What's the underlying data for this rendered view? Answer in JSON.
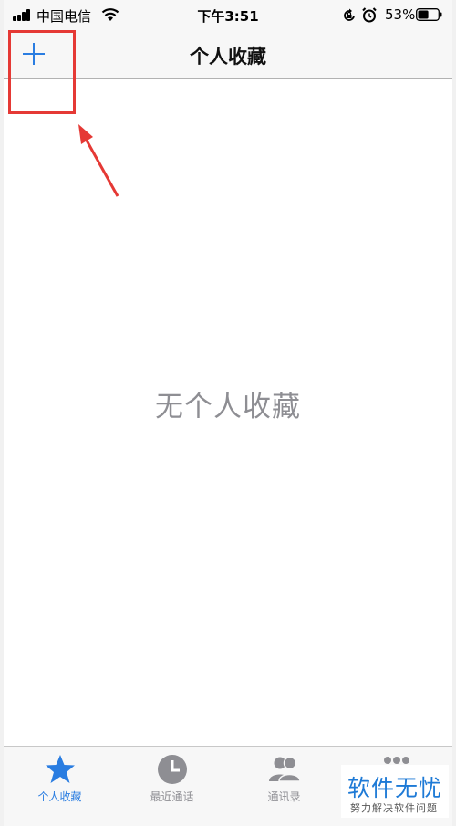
{
  "status_bar": {
    "carrier": "中国电信",
    "time": "下午3:51",
    "battery_percent": "53%",
    "battery_level": 0.53
  },
  "nav": {
    "title": "个人收藏",
    "add_icon": "plus-icon"
  },
  "main": {
    "empty_text": "无个人收藏"
  },
  "tabs": [
    {
      "label": "个人收藏",
      "icon": "star-icon",
      "active": true
    },
    {
      "label": "最近通话",
      "icon": "clock-icon",
      "active": false
    },
    {
      "label": "通讯录",
      "icon": "contacts-icon",
      "active": false
    },
    {
      "label": "",
      "icon": "keypad-icon",
      "active": false
    }
  ],
  "watermark": {
    "main": "软件无忧",
    "sub": "努力解决软件问题"
  },
  "colors": {
    "accent": "#2a7de1",
    "annotation": "#e53935",
    "inactive": "#8e8e93"
  }
}
